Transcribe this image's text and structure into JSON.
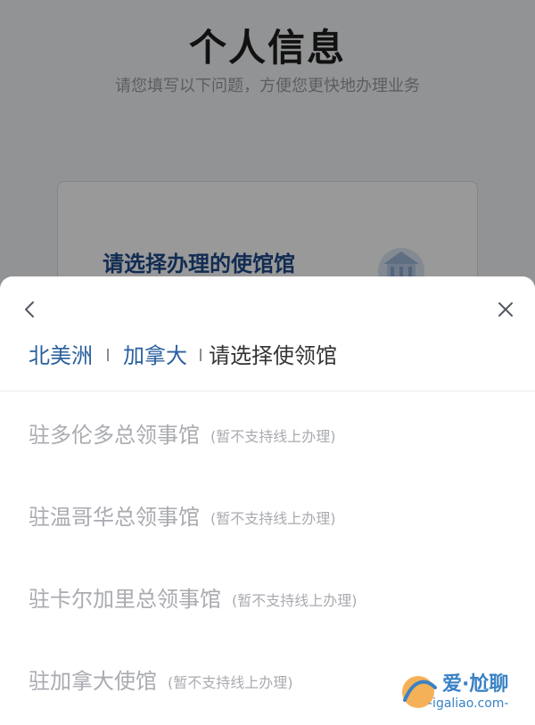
{
  "background": {
    "title": "个人信息",
    "subtitle": "请您填写以下问题，方便您更快地办理业务",
    "card_prompt": "请选择办理的使馆馆"
  },
  "sheet": {
    "back_icon": "chevron-left-icon",
    "close_icon": "close-icon",
    "breadcrumb": {
      "region": "北美洲",
      "country": "加拿大",
      "current": "请选择使领馆"
    },
    "consulates": [
      {
        "name": "驻多伦多总领事馆",
        "note": "(暂不支持线上办理)"
      },
      {
        "name": "驻温哥华总领事馆",
        "note": "(暂不支持线上办理)"
      },
      {
        "name": "驻卡尔加里总领事馆",
        "note": "(暂不支持线上办理)"
      },
      {
        "name": "驻加拿大使馆",
        "note": "(暂不支持线上办理)"
      }
    ]
  },
  "watermark": {
    "text": "爱·尬聊",
    "url": "-igaliao.com-"
  },
  "colors": {
    "link_blue": "#2a5f9e",
    "disabled_text": "#a9abb0",
    "card_title": "#1e4a8a"
  }
}
